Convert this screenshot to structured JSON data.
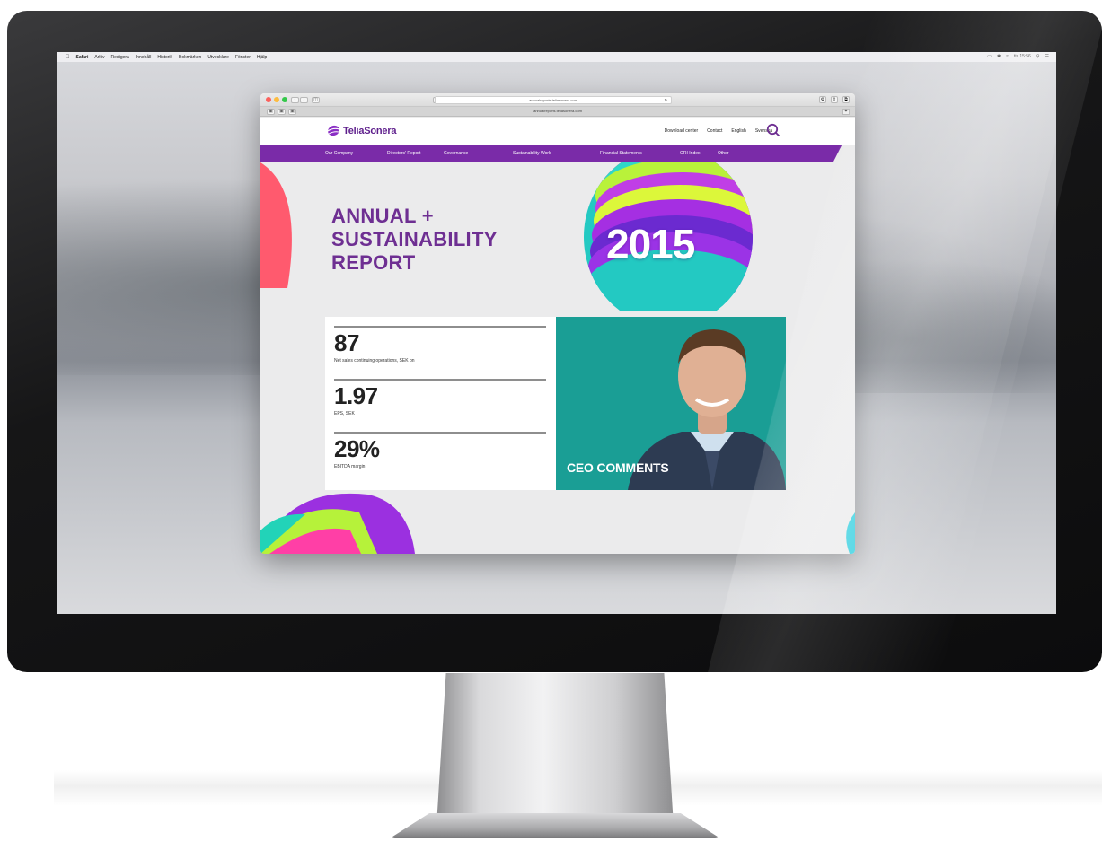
{
  "menubar": {
    "items": [
      "Safari",
      "Arkiv",
      "Redigera",
      "Innehåll",
      "Historik",
      "Bokmärken",
      "Utvecklare",
      "Fönster",
      "Hjälp"
    ],
    "clock": "tis 15:56"
  },
  "browser": {
    "url": "annualreports.teliasonera.com",
    "tab_title": "annualreports.teliasonera.com"
  },
  "site": {
    "logo_text": "TeliaSonera",
    "util_nav": [
      "Download center",
      "Contact",
      "English",
      "Svenska"
    ],
    "main_nav": [
      "Our Company",
      "Directors' Report",
      "Governance",
      "Sustainability Work",
      "Financial Statements",
      "GRI Index",
      "Other"
    ],
    "hero_lines": [
      "ANNUAL +",
      "SUSTAINABILITY",
      "REPORT"
    ],
    "year": "2015",
    "stats": [
      {
        "value": "87",
        "label": "Net sales continuing operations, SEK bn"
      },
      {
        "value": "1.97",
        "label": "EPS, SEK"
      },
      {
        "value": "29%",
        "label": "EBITDA margin"
      }
    ],
    "ceo_label": "CEO COMMENTS"
  },
  "colors": {
    "brand_purple": "#7a2ba8",
    "title_purple": "#6e2f92",
    "ceo_teal": "#1a9e95"
  }
}
